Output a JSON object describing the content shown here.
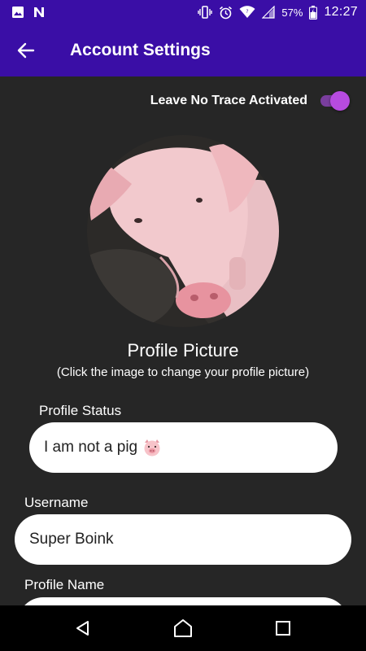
{
  "status_bar": {
    "time": "12:27",
    "battery_percent": "57%",
    "icons_left": [
      "image-icon",
      "n-notification-icon"
    ],
    "icons_right": [
      "vibrate-icon",
      "alarm-icon",
      "wifi-icon",
      "signal-icon",
      "battery-icon"
    ]
  },
  "app_bar": {
    "title": "Account Settings",
    "back_icon": "arrow-left-icon",
    "background": "#3a0ea6"
  },
  "leave_no_trace": {
    "label": "Leave No Trace Activated",
    "enabled": true,
    "accent": "#b74be0"
  },
  "profile_picture": {
    "title": "Profile Picture",
    "hint": "(Click the image to change your profile picture)"
  },
  "form": {
    "status_label": "Profile Status",
    "status_value": "I am not a pig",
    "username_label": "Username",
    "username_value": "Super Boink",
    "profile_name_label": "Profile Name",
    "profile_name_value": ""
  },
  "nav_bar": {
    "icons": [
      "back-triangle-icon",
      "home-icon",
      "recents-square-icon"
    ]
  },
  "colors": {
    "background": "#262626",
    "primary": "#3a0ea6",
    "field_bg": "#ffffff"
  }
}
